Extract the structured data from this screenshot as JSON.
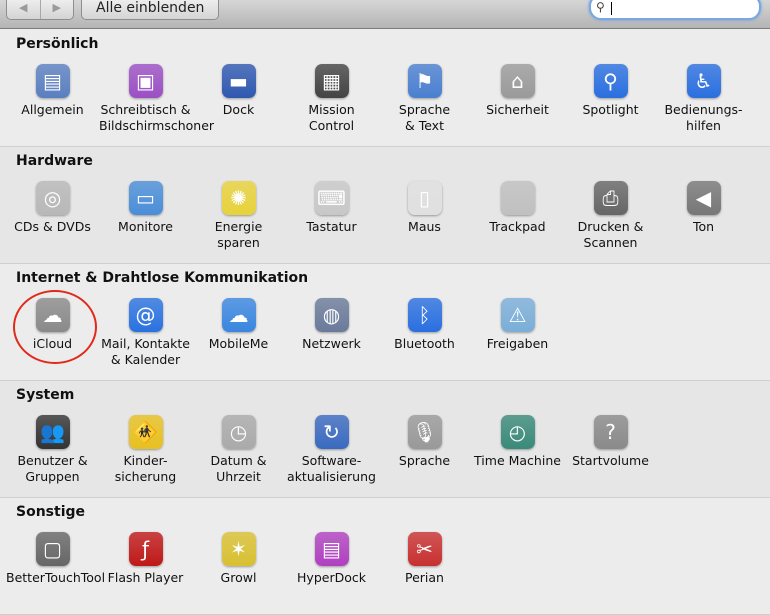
{
  "toolbar": {
    "back": "◀",
    "forward": "▶",
    "show_all": "Alle einblenden",
    "search_icon": "magnifier-icon",
    "search_value": ""
  },
  "sections": [
    {
      "title": "Persönlich",
      "items": [
        {
          "label": "Allgemein",
          "icon": "general-icon",
          "glyph": "▤",
          "color": "#5a7fc0"
        },
        {
          "label": "Schreibtisch &\nBildschirmschoner",
          "icon": "desktop-icon",
          "glyph": "▣",
          "color": "#9b4fc4"
        },
        {
          "label": "Dock",
          "icon": "dock-icon",
          "glyph": "▬",
          "color": "#2f58b0"
        },
        {
          "label": "Mission\nControl",
          "icon": "mission-control-icon",
          "glyph": "▦",
          "color": "#444444"
        },
        {
          "label": "Sprache\n& Text",
          "icon": "flag-icon",
          "glyph": "⚑",
          "color": "#4a7fd0"
        },
        {
          "label": "Sicherheit",
          "icon": "house-icon",
          "glyph": "⌂",
          "color": "#9a9a9a"
        },
        {
          "label": "Spotlight",
          "icon": "spotlight-icon",
          "glyph": "⚲",
          "color": "#2a6fe0"
        },
        {
          "label": "Bedienungs-\nhilfen",
          "icon": "accessibility-icon",
          "glyph": "♿",
          "color": "#2a6fe0"
        }
      ]
    },
    {
      "title": "Hardware",
      "items": [
        {
          "label": "CDs & DVDs",
          "icon": "disc-icon",
          "glyph": "◎",
          "color": "#b8b8b8"
        },
        {
          "label": "Monitore",
          "icon": "monitor-icon",
          "glyph": "▭",
          "color": "#4a8ed8"
        },
        {
          "label": "Energie\nsparen",
          "icon": "bulb-icon",
          "glyph": "✺",
          "color": "#e8d23a"
        },
        {
          "label": "Tastatur",
          "icon": "keyboard-icon",
          "glyph": "⌨",
          "color": "#c8c8c8"
        },
        {
          "label": "Maus",
          "icon": "mouse-icon",
          "glyph": "▯",
          "color": "#e0e0e0"
        },
        {
          "label": "Trackpad",
          "icon": "trackpad-icon",
          "glyph": "",
          "color": "#c0c0c0"
        },
        {
          "label": "Drucken &\nScannen",
          "icon": "printer-icon",
          "glyph": "⎙",
          "color": "#666666"
        },
        {
          "label": "Ton",
          "icon": "speaker-icon",
          "glyph": "◀",
          "color": "#777777"
        }
      ]
    },
    {
      "title": "Internet & Drahtlose Kommunikation",
      "items": [
        {
          "label": "iCloud",
          "icon": "cloud-icon",
          "glyph": "☁",
          "color": "#8a8a8a"
        },
        {
          "label": "Mail, Kontakte\n& Kalender",
          "icon": "at-icon",
          "glyph": "@",
          "color": "#2a72e0"
        },
        {
          "label": "MobileMe",
          "icon": "mobileme-icon",
          "glyph": "☁",
          "color": "#3a86e0"
        },
        {
          "label": "Netzwerk",
          "icon": "globe-icon",
          "glyph": "◍",
          "color": "#6a7a9a"
        },
        {
          "label": "Bluetooth",
          "icon": "bluetooth-icon",
          "glyph": "ᛒ",
          "color": "#2a6fe0"
        },
        {
          "label": "Freigaben",
          "icon": "folder-icon",
          "glyph": "⚠",
          "color": "#7aaed8"
        }
      ]
    },
    {
      "title": "System",
      "items": [
        {
          "label": "Benutzer &\nGruppen",
          "icon": "users-icon",
          "glyph": "👥",
          "color": "#333333"
        },
        {
          "label": "Kinder-\nsicherung",
          "icon": "parental-icon",
          "glyph": "🚸",
          "color": "#e8c020"
        },
        {
          "label": "Datum &\nUhrzeit",
          "icon": "clock-icon",
          "glyph": "◷",
          "color": "#aaaaaa"
        },
        {
          "label": "Software-\naktualisierung",
          "icon": "update-icon",
          "glyph": "↻",
          "color": "#3a6ac0"
        },
        {
          "label": "Sprache",
          "icon": "microphone-icon",
          "glyph": "🎙",
          "color": "#999999"
        },
        {
          "label": "Time Machine",
          "icon": "time-machine-icon",
          "glyph": "◴",
          "color": "#3a8a7a"
        },
        {
          "label": "Startvolume",
          "icon": "disk-icon",
          "glyph": "?",
          "color": "#8a8a8a"
        }
      ]
    },
    {
      "title": "Sonstige",
      "items": [
        {
          "label": "BetterTouchTool",
          "icon": "bettertouchtool-icon",
          "glyph": "▢",
          "color": "#666666"
        },
        {
          "label": "Flash Player",
          "icon": "flash-icon",
          "glyph": "ƒ",
          "color": "#c01818"
        },
        {
          "label": "Growl",
          "icon": "growl-icon",
          "glyph": "✶",
          "color": "#d8c030"
        },
        {
          "label": "HyperDock",
          "icon": "hyperdock-icon",
          "glyph": "▤",
          "color": "#b040c0"
        },
        {
          "label": "Perian",
          "icon": "perian-icon",
          "glyph": "✂",
          "color": "#c83030"
        }
      ]
    }
  ]
}
